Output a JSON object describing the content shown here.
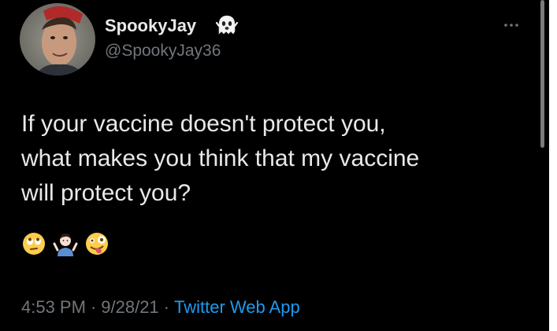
{
  "tweet": {
    "author": {
      "display_name": "SpookyJay",
      "name_emoji": "ghost-icon",
      "handle": "@SpookyJay36"
    },
    "menu": {
      "icon": "more-horizontal-icon"
    },
    "text_lines": [
      "If your vaccine doesn't protect you,",
      "what makes you think that my vaccine",
      "will protect you?"
    ],
    "emojis": [
      "face-with-rolling-eyes-icon",
      "person-shrugging-icon",
      "zany-face-icon"
    ],
    "meta": {
      "time": "4:53 PM",
      "separator": "·",
      "date": "9/28/21",
      "source": "Twitter Web App"
    }
  },
  "colors": {
    "background": "#000000",
    "primary_text": "#e7e9ea",
    "secondary_text": "#71767b",
    "link": "#1d9bf0"
  }
}
